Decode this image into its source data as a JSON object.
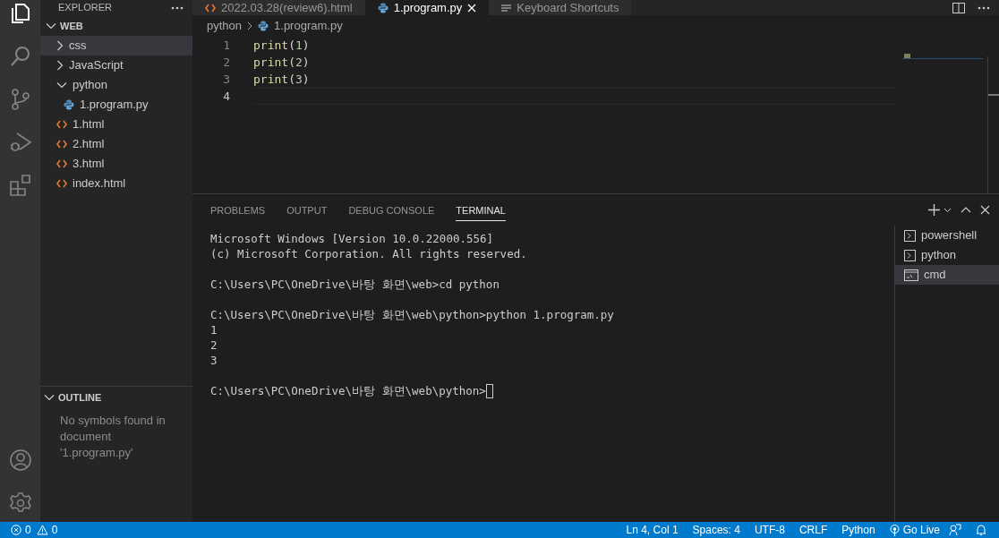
{
  "activity_bar": [
    {
      "kind": "files",
      "selected": true
    },
    {
      "kind": "search",
      "selected": false
    },
    {
      "kind": "source-control",
      "selected": false
    },
    {
      "kind": "debug",
      "selected": false
    },
    {
      "kind": "extensions",
      "selected": false
    }
  ],
  "activity_bottom": [
    {
      "kind": "account"
    },
    {
      "kind": "settings"
    }
  ],
  "explorer": {
    "title": "EXPLORER",
    "root": {
      "label": "WEB",
      "expanded": true
    },
    "tree": [
      {
        "label": "css",
        "kind": "folder",
        "expanded": false,
        "selected": true
      },
      {
        "label": "JavaScript",
        "kind": "folder",
        "expanded": false,
        "selected": false
      },
      {
        "label": "python",
        "kind": "folder",
        "expanded": true,
        "selected": false,
        "children": [
          {
            "label": "1.program.py",
            "kind": "python",
            "selected": false
          }
        ]
      },
      {
        "label": "1.html",
        "kind": "html",
        "selected": false
      },
      {
        "label": "2.html",
        "kind": "html",
        "selected": false
      },
      {
        "label": "3.html",
        "kind": "html",
        "selected": false
      },
      {
        "label": "index.html",
        "kind": "html",
        "selected": false
      }
    ]
  },
  "outline": {
    "title": "OUTLINE",
    "expanded": true,
    "message": "No symbols found in document '1.program.py'"
  },
  "tabs": [
    {
      "label": "2022.03.28(review6).html",
      "kind": "html",
      "selected": false
    },
    {
      "label": "1.program.py",
      "kind": "python",
      "selected": true
    },
    {
      "label": "Keyboard Shortcuts",
      "kind": "shortcuts",
      "selected": false
    }
  ],
  "breadcrumb": [
    "python",
    "1.program.py"
  ],
  "editor": {
    "lines": [
      {
        "number": "1",
        "current": false,
        "tokens": [
          {
            "text": "print",
            "kind": "function"
          },
          {
            "text": "(",
            "kind": "punct"
          },
          {
            "text": "1",
            "kind": "number"
          },
          {
            "text": ")",
            "kind": "punct"
          }
        ]
      },
      {
        "number": "2",
        "current": false,
        "tokens": [
          {
            "text": "print",
            "kind": "function"
          },
          {
            "text": "(",
            "kind": "punct"
          },
          {
            "text": "2",
            "kind": "number"
          },
          {
            "text": ")",
            "kind": "punct"
          }
        ]
      },
      {
        "number": "3",
        "current": false,
        "tokens": [
          {
            "text": "print",
            "kind": "function"
          },
          {
            "text": "(",
            "kind": "punct"
          },
          {
            "text": "3",
            "kind": "number"
          },
          {
            "text": ")",
            "kind": "punct"
          }
        ]
      },
      {
        "number": "4",
        "current": true
      }
    ]
  },
  "panel_tabs": [
    {
      "label": "PROBLEMS",
      "selected": false
    },
    {
      "label": "OUTPUT",
      "selected": false
    },
    {
      "label": "DEBUG CONSOLE",
      "selected": false
    },
    {
      "label": "TERMINAL",
      "selected": true
    }
  ],
  "terminal": [
    {
      "text": "Microsoft Windows [Version 10.0.22000.556]",
      "gap_before": false,
      "cursor": false
    },
    {
      "text": "(c) Microsoft Corporation. All rights reserved.",
      "gap_before": false,
      "cursor": false
    },
    {
      "text": "C:\\Users\\PC\\OneDrive\\바탕 화면\\web>cd python",
      "gap_before": true,
      "cursor": false
    },
    {
      "text": "C:\\Users\\PC\\OneDrive\\바탕 화면\\web\\python>python 1.program.py",
      "gap_before": true,
      "cursor": false
    },
    {
      "text": "1",
      "gap_before": false,
      "cursor": false
    },
    {
      "text": "2",
      "gap_before": false,
      "cursor": false
    },
    {
      "text": "3",
      "gap_before": false,
      "cursor": false
    },
    {
      "text": "C:\\Users\\PC\\OneDrive\\바탕 화면\\web\\python>",
      "gap_before": true,
      "cursor": true
    }
  ],
  "terminals": [
    {
      "name": "powershell",
      "kind": "shell",
      "selected": false
    },
    {
      "name": "python",
      "kind": "shell",
      "selected": false
    },
    {
      "name": "cmd",
      "kind": "cmd",
      "selected": true
    }
  ],
  "status_bar": {
    "errors": "0",
    "warnings": "0",
    "items": [
      {
        "text": "Ln 4, Col 1",
        "kind": "text"
      },
      {
        "text": "Spaces: 4",
        "kind": "text"
      },
      {
        "text": "UTF-8",
        "kind": "text"
      },
      {
        "text": "CRLF",
        "kind": "text"
      },
      {
        "text": "Python",
        "kind": "text"
      },
      {
        "text": "Go Live",
        "kind": "live"
      }
    ]
  }
}
